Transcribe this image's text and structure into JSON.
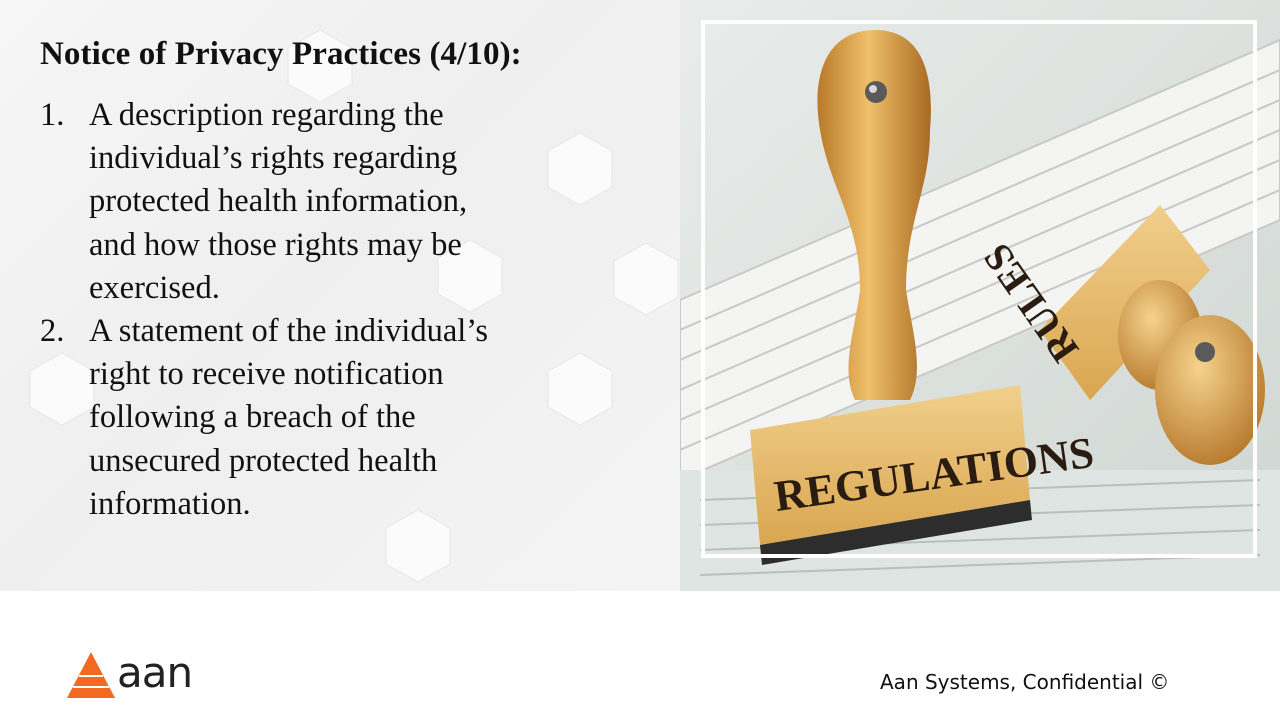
{
  "slide": {
    "title": "Notice of Privacy Practices (4/10):",
    "items": [
      {
        "number": "1.",
        "lines": [
          "A description regarding the",
          "individual’s rights regarding",
          "protected health information,",
          "and how those rights may be",
          "exercised."
        ]
      },
      {
        "number": "2.",
        "lines": [
          "A statement of the individual’s",
          "right to receive notification",
          "following a breach of the",
          "unsecured protected health",
          "information."
        ]
      }
    ]
  },
  "image": {
    "stamp_regulations": "REGULATIONS",
    "stamp_rules": "RULES"
  },
  "footer": {
    "logo_text": "aan",
    "confidential": "Aan Systems, Confidential ©"
  },
  "colors": {
    "logo_orange": "#f26a21",
    "text": "#111111",
    "frame": "#ffffff",
    "wood": "#d9a24b"
  }
}
